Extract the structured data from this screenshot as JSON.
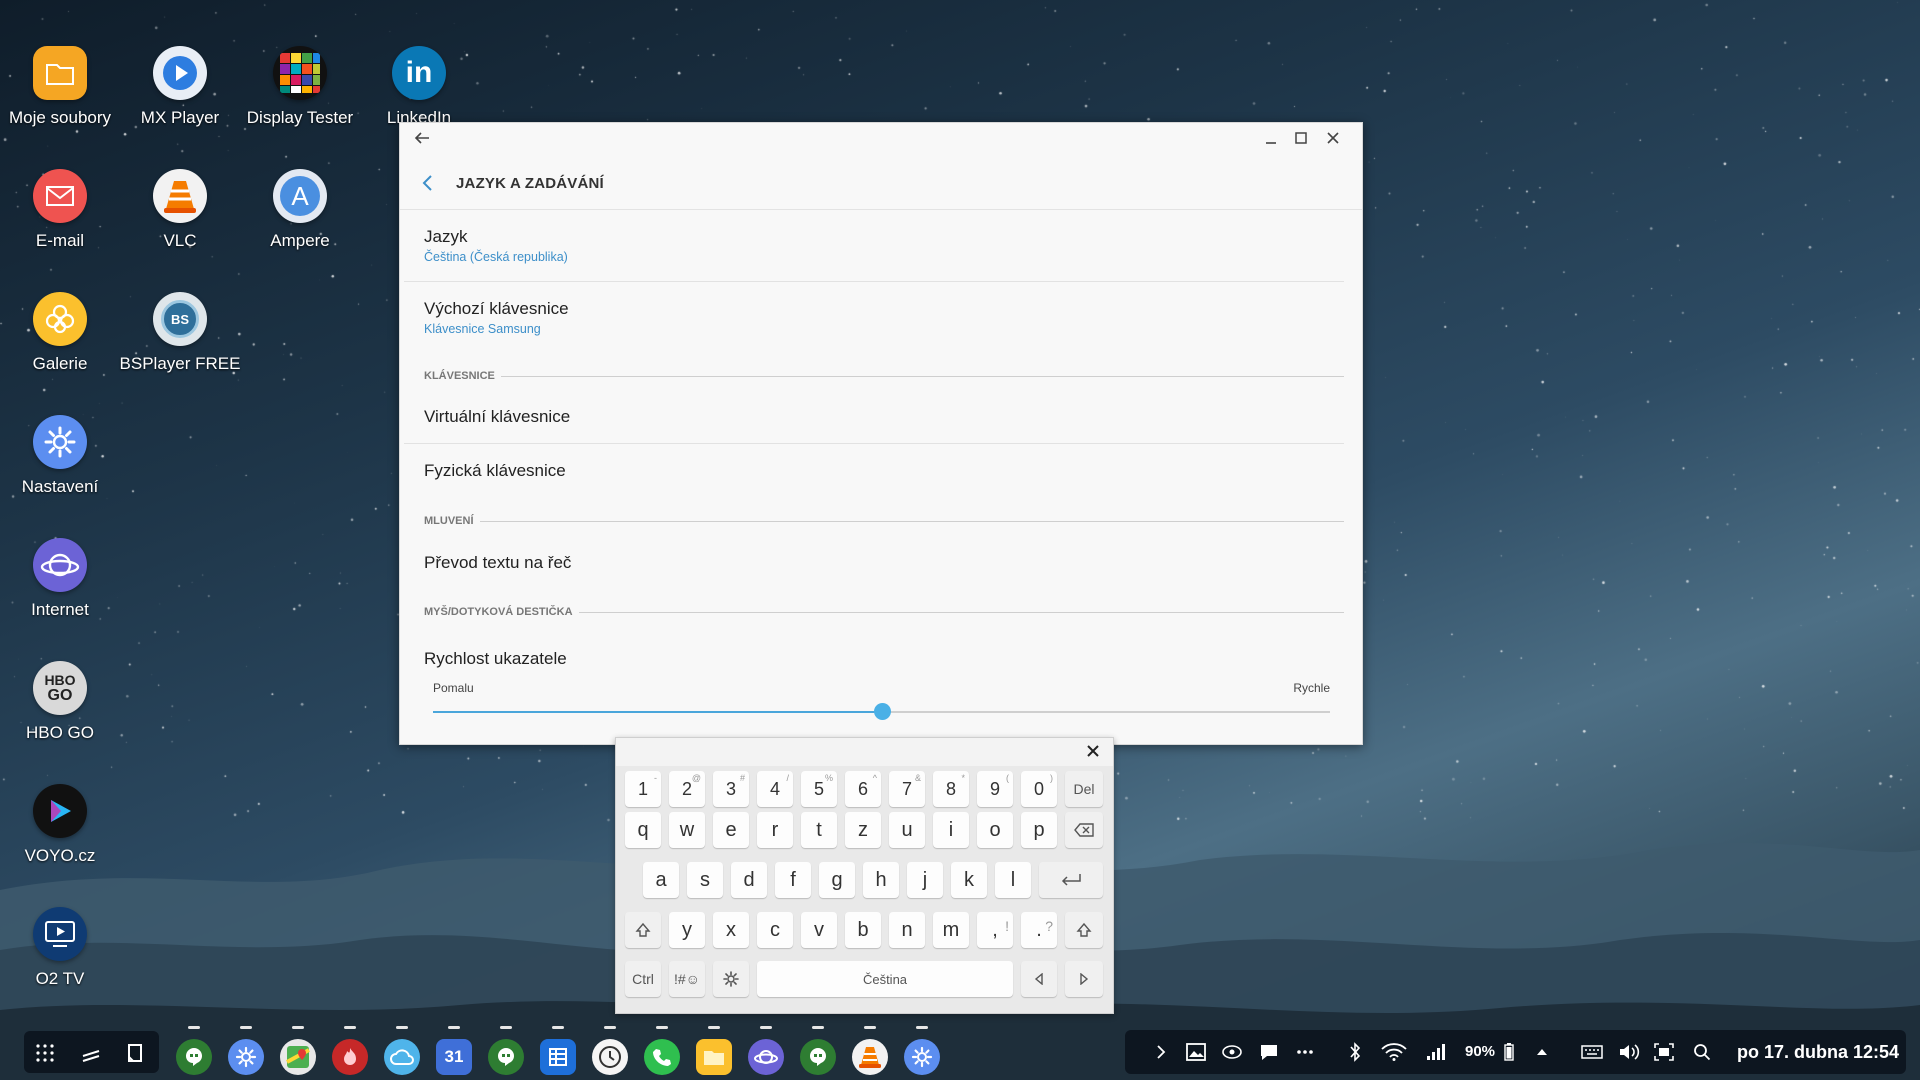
{
  "desktop": {
    "icons": [
      {
        "label": "Moje soubory"
      },
      {
        "label": "MX Player"
      },
      {
        "label": "Display Tester"
      },
      {
        "label": "LinkedIn"
      },
      {
        "label": "E-mail"
      },
      {
        "label": "VLC"
      },
      {
        "label": "Ampere"
      },
      {
        "label": "Galerie"
      },
      {
        "label": "BSPlayer FREE"
      },
      {
        "label": "Nastavení"
      },
      {
        "label": "Internet"
      },
      {
        "label": "HBO GO"
      },
      {
        "label": "VOYO.cz"
      },
      {
        "label": "O2 TV"
      }
    ],
    "icon_text": {
      "linkedin": "in",
      "ampere": "A",
      "bsplayer": "BS",
      "hbo": "HBO",
      "hbo_go": "GO"
    }
  },
  "window": {
    "header_title": "JAZYK A ZADÁVÁNÍ",
    "rows": {
      "language": {
        "title": "Jazyk",
        "value": "Čeština (Česká republika)"
      },
      "default_keyboard": {
        "title": "Výchozí klávesnice",
        "value": "Klávesnice Samsung"
      },
      "virtual_keyboard": {
        "title": "Virtuální klávesnice"
      },
      "physical_keyboard": {
        "title": "Fyzická klávesnice"
      },
      "tts": {
        "title": "Převod textu na řeč"
      },
      "pointer_speed": {
        "title": "Rychlost ukazatele",
        "min_label": "Pomalu",
        "max_label": "Rychle"
      }
    },
    "sections": {
      "keyboards": "KLÁVESNICE",
      "speech": "MLUVENÍ",
      "mouse": "MYŠ/DOTYKOVÁ DESTIČKA"
    },
    "pointer_speed_value": 0.5
  },
  "keyboard": {
    "number_row": [
      {
        "k": "1",
        "s": "-"
      },
      {
        "k": "2",
        "s": "@"
      },
      {
        "k": "3",
        "s": "#"
      },
      {
        "k": "4",
        "s": "/"
      },
      {
        "k": "5",
        "s": "%"
      },
      {
        "k": "6",
        "s": "^"
      },
      {
        "k": "7",
        "s": "&"
      },
      {
        "k": "8",
        "s": "*"
      },
      {
        "k": "9",
        "s": "("
      },
      {
        "k": "0",
        "s": ")"
      }
    ],
    "del_label": "Del",
    "row1": [
      "q",
      "w",
      "e",
      "r",
      "t",
      "z",
      "u",
      "i",
      "o",
      "p"
    ],
    "row2": [
      "a",
      "s",
      "d",
      "f",
      "g",
      "h",
      "j",
      "k",
      "l"
    ],
    "row3": [
      "y",
      "x",
      "c",
      "v",
      "b",
      "n",
      "m"
    ],
    "comma_key": {
      "k": ",",
      "s": "!"
    },
    "period_key": {
      "k": ".",
      "s": "?"
    },
    "ctrl_label": "Ctrl",
    "symbols_label": "!#☺",
    "space_label": "Čeština"
  },
  "taskbar": {
    "battery": "90%",
    "clock": "po 17. dubna 12:54",
    "calendar_day": "31"
  },
  "colors": {
    "accent": "#4aa6db",
    "subtext": "#3d8fc9"
  }
}
